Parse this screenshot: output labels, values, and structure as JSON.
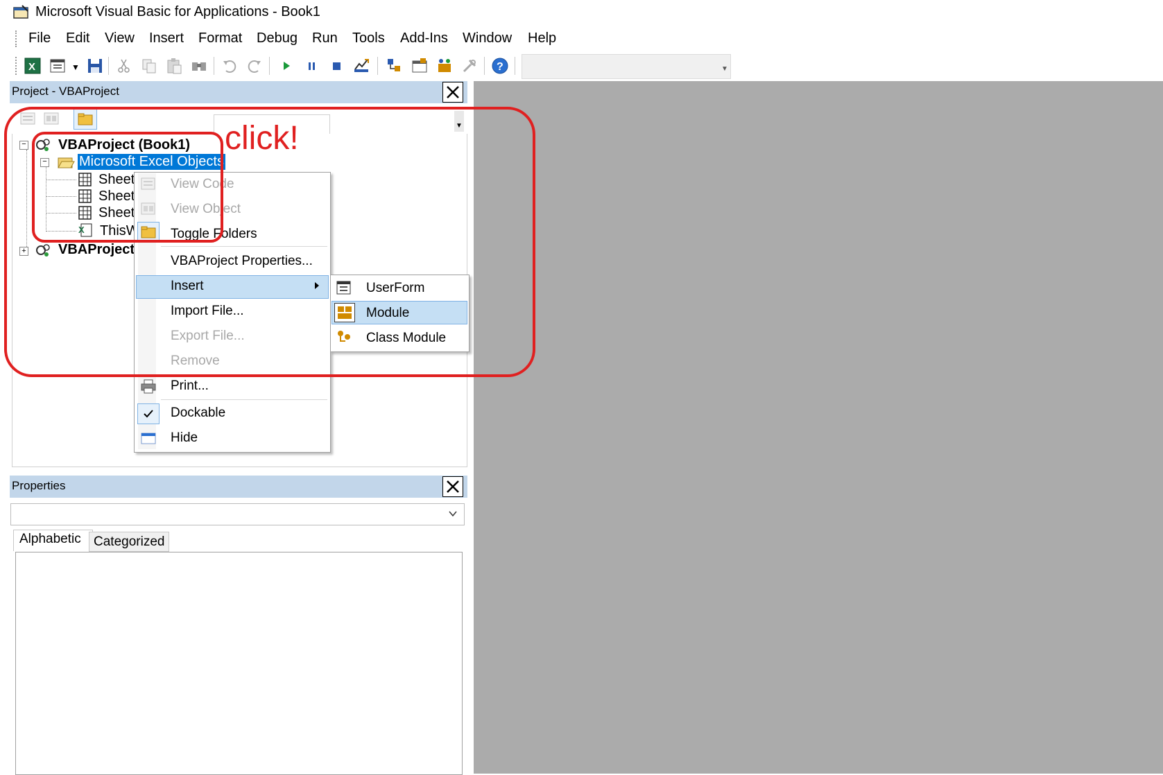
{
  "window": {
    "title": "Microsoft Visual Basic for Applications - Book1"
  },
  "menubar": {
    "items": [
      {
        "label": "File"
      },
      {
        "label": "Edit"
      },
      {
        "label": "View"
      },
      {
        "label": "Insert"
      },
      {
        "label": "Format"
      },
      {
        "label": "Debug"
      },
      {
        "label": "Run"
      },
      {
        "label": "Tools"
      },
      {
        "label": "Add-Ins"
      },
      {
        "label": "Window"
      },
      {
        "label": "Help"
      }
    ]
  },
  "toolbar": {
    "icons": [
      "excel-icon",
      "insert-userform-icon",
      "save-icon",
      "cut-icon",
      "copy-icon",
      "paste-icon",
      "find-icon",
      "undo-icon",
      "redo-icon",
      "run-icon",
      "break-icon",
      "reset-icon",
      "design-mode-icon",
      "project-explorer-icon",
      "properties-icon",
      "object-browser-icon",
      "toolbox-icon",
      "help-icon"
    ]
  },
  "project_pane": {
    "title": "Project - VBAProject",
    "tree": {
      "root1": "VBAProject (Book1)",
      "folder": "Microsoft Excel Objects",
      "children": [
        "Sheet",
        "Sheet",
        "Sheet",
        "ThisW"
      ],
      "root2": "VBAProject"
    }
  },
  "properties_pane": {
    "title": "Properties",
    "tabs": [
      "Alphabetic",
      "Categorized"
    ]
  },
  "context_menu": {
    "items": {
      "view_code": "View Code",
      "view_object": "View Object",
      "toggle_folders": "Toggle Folders",
      "properties": "VBAProject Properties...",
      "insert": "Insert",
      "import_file": "Import File...",
      "export_file": "Export File...",
      "remove": "Remove",
      "print": "Print...",
      "dockable": "Dockable",
      "hide": "Hide"
    }
  },
  "submenu": {
    "items": {
      "userform": "UserForm",
      "module": "Module",
      "class_module": "Class Module"
    }
  },
  "annotation": {
    "label": "click!",
    "color": "#e02020"
  },
  "colors": {
    "pane_header": "#c2d6ea",
    "workspace": "#ababab",
    "highlight": "#c5dff4",
    "selection": "#0078d7"
  }
}
